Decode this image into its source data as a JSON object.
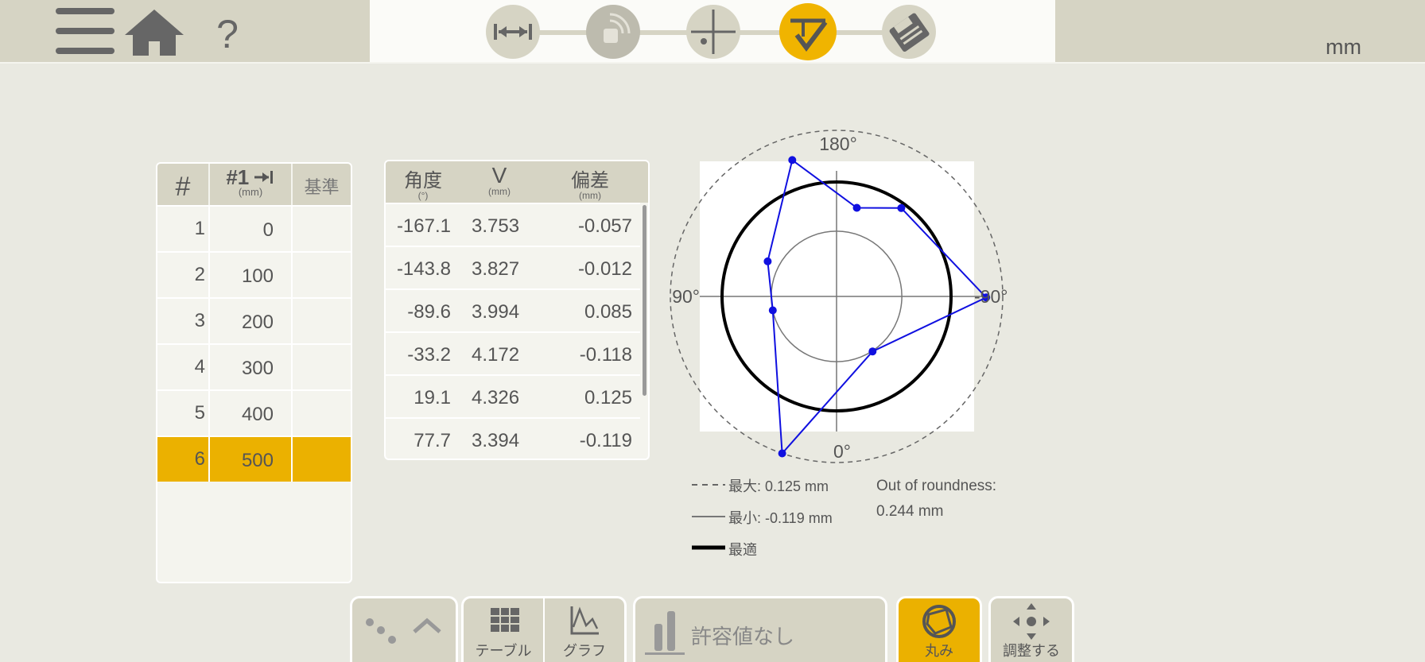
{
  "top_bar": {
    "units": "mm",
    "workflow_steps": [
      "distance",
      "connect",
      "setup",
      "measure",
      "save"
    ],
    "active_step": "measure"
  },
  "left_table": {
    "headers": {
      "num": "#",
      "pos": "#1",
      "pos_unit": "(mm)",
      "ref": "基準"
    },
    "rows": [
      {
        "num": "1",
        "value": "0"
      },
      {
        "num": "2",
        "value": "100"
      },
      {
        "num": "3",
        "value": "200"
      },
      {
        "num": "4",
        "value": "300"
      },
      {
        "num": "5",
        "value": "400"
      },
      {
        "num": "6",
        "value": "500"
      }
    ],
    "selected_row": 6
  },
  "mid_table": {
    "headers": {
      "angle": "角度",
      "angle_unit": "(°)",
      "v": "V",
      "v_unit": "(mm)",
      "dev": "偏差",
      "dev_unit": "(mm)"
    },
    "rows": [
      {
        "angle": "-167.1",
        "v": "3.753",
        "dev": "-0.057"
      },
      {
        "angle": "-143.8",
        "v": "3.827",
        "dev": "-0.012"
      },
      {
        "angle": "-89.6",
        "v": "3.994",
        "dev": "0.085"
      },
      {
        "angle": "-33.2",
        "v": "4.172",
        "dev": "-0.118"
      },
      {
        "angle": "19.1",
        "v": "4.326",
        "dev": "0.125"
      },
      {
        "angle": "77.7",
        "v": "3.394",
        "dev": "-0.119"
      }
    ]
  },
  "chart_data": {
    "type": "scatter",
    "subtype": "polar",
    "angle_labels": {
      "top": "180°",
      "right": "-90°",
      "bottom": "0°",
      "left": "90°"
    },
    "points": [
      {
        "angle": -167.1,
        "deviation": -0.057
      },
      {
        "angle": -143.8,
        "deviation": -0.012
      },
      {
        "angle": -89.6,
        "deviation": 0.085
      },
      {
        "angle": -33.2,
        "deviation": -0.118
      },
      {
        "angle": 19.1,
        "deviation": 0.125
      },
      {
        "angle": 77.7,
        "deviation": -0.119
      },
      {
        "angle": 117.0,
        "deviation": -0.09
      },
      {
        "angle": 162.0,
        "deviation": 0.07
      }
    ],
    "max_deviation": 0.125,
    "min_deviation": -0.119,
    "series_colors": {
      "points": "#1010e0",
      "best_fit": "#000000",
      "max": "#666666",
      "min": "#777777"
    }
  },
  "legend": {
    "max": "最大: 0.125 mm",
    "min": "最小: -0.119 mm",
    "best": "最適",
    "oor_label": "Out of roundness:",
    "oor_value": "0.244 mm"
  },
  "bottom_bar": {
    "table_label": "テーブル",
    "graph_label": "グラフ",
    "tolerance_label": "許容値なし",
    "roundness_label": "丸み",
    "adjust_label": "調整する"
  },
  "colors": {
    "accent": "#ebb100",
    "panel": "#d6d4c4",
    "background": "#e9e9e1"
  }
}
